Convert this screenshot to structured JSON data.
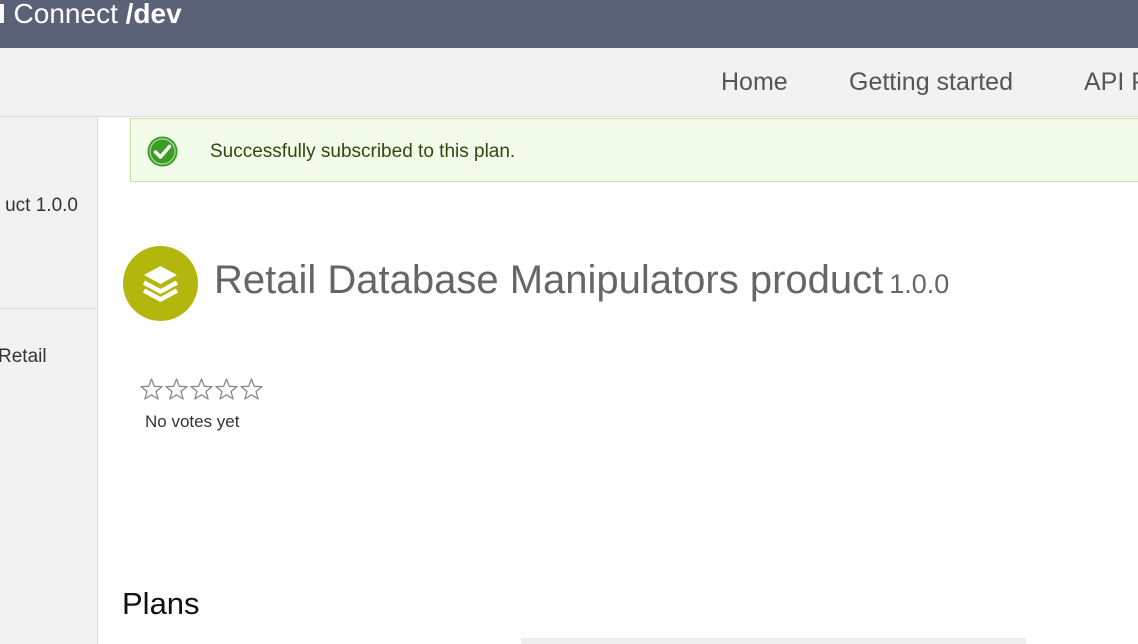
{
  "header": {
    "brand_prefix": "I",
    "brand_middle": " Connect ",
    "brand_suffix": "/dev"
  },
  "nav": {
    "home": "Home",
    "getting_started": "Getting started",
    "api": "API P"
  },
  "sidebar": {
    "items": [
      {
        "label": "uct 1.0.0"
      },
      {
        "label": "Retail"
      }
    ]
  },
  "alert": {
    "message": "Successfully subscribed to this plan.",
    "icon": "check-circle-icon",
    "color": "#3a9d23"
  },
  "product": {
    "title": "Retail Database Manipulators product",
    "version": "1.0.0",
    "icon": "stack-layers-icon",
    "icon_color": "#b3b60c"
  },
  "rating": {
    "stars_total": 5,
    "stars_filled": 0,
    "votes_text": "No votes yet"
  },
  "plans": {
    "heading": "Plans"
  }
}
